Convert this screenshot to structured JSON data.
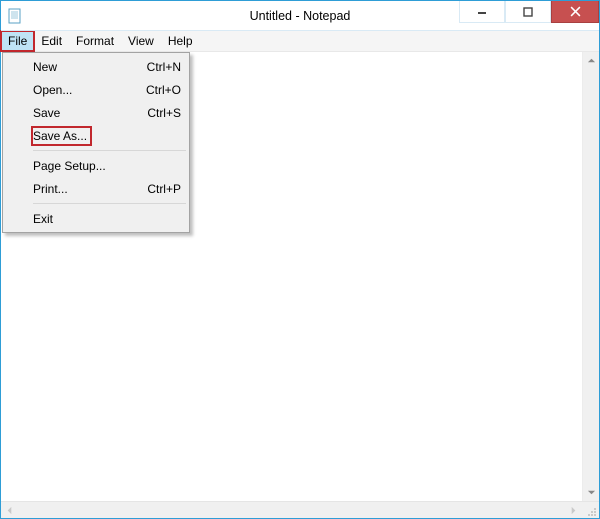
{
  "window": {
    "title": "Untitled - Notepad"
  },
  "menubar": {
    "items": [
      {
        "label": "File"
      },
      {
        "label": "Edit"
      },
      {
        "label": "Format"
      },
      {
        "label": "View"
      },
      {
        "label": "Help"
      }
    ]
  },
  "file_menu": {
    "new": {
      "label": "New",
      "shortcut": "Ctrl+N"
    },
    "open": {
      "label": "Open...",
      "shortcut": "Ctrl+O"
    },
    "save": {
      "label": "Save",
      "shortcut": "Ctrl+S"
    },
    "save_as": {
      "label": "Save As...",
      "shortcut": ""
    },
    "page_setup": {
      "label": "Page Setup...",
      "shortcut": ""
    },
    "print": {
      "label": "Print...",
      "shortcut": "Ctrl+P"
    },
    "exit": {
      "label": "Exit",
      "shortcut": ""
    }
  }
}
